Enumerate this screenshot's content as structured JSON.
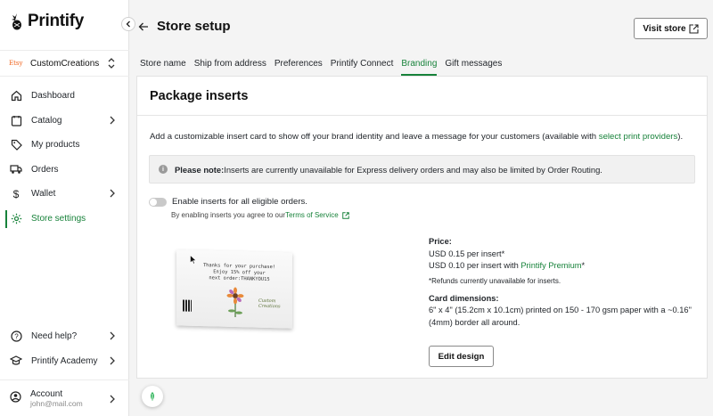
{
  "app": {
    "name": "Printify"
  },
  "store": {
    "platform": "Etsy",
    "name": "CustomCreations"
  },
  "nav": {
    "items": [
      {
        "label": "Dashboard"
      },
      {
        "label": "Catalog"
      },
      {
        "label": "My products"
      },
      {
        "label": "Orders"
      },
      {
        "label": "Wallet"
      },
      {
        "label": "Store settings"
      }
    ],
    "help": "Need help?",
    "academy": "Printify Academy"
  },
  "account": {
    "label": "Account",
    "email": "john@mail.com"
  },
  "header": {
    "title": "Store setup",
    "visit_store": "Visit store"
  },
  "tabs": [
    {
      "label": "Store name"
    },
    {
      "label": "Ship from address"
    },
    {
      "label": "Preferences"
    },
    {
      "label": "Printify Connect"
    },
    {
      "label": "Branding"
    },
    {
      "label": "Gift messages"
    }
  ],
  "inserts": {
    "heading": "Package inserts",
    "description": "Add a customizable insert card to show off your brand identity and leave a message for your customers (available with ",
    "description_link": "select print providers",
    "description_end": ").",
    "note_bold": "Please note:",
    "note_text": " Inserts are currently unavailable for Express delivery orders and may also be limited by Order Routing.",
    "toggle_label": "Enable inserts for all eligible orders.",
    "toggle_on": false,
    "terms_prefix": "By enabling inserts you agree to our ",
    "terms_link": "Terms of Service",
    "card_line1": "Thanks for your purchase!",
    "card_line2": "Enjoy 15% off your",
    "card_line3": "next order:THANKYOU15",
    "card_brand1": "Custom",
    "card_brand2": "Creations",
    "price_label": "Price:",
    "price_line1": "USD 0.15 per insert*",
    "price_line2_prefix": "USD 0.10 per insert with ",
    "price_line2_link": "Printify Premium",
    "price_line2_suffix": "*",
    "refunds_note": "*Refunds currently unavailable for inserts.",
    "dimensions_label": "Card dimensions:",
    "dimensions_line1": "6\" x 4\" (15.2cm x 10.1cm) printed on 150 - 170 gsm paper with a ~0.16\"",
    "dimensions_line2": "(4mm) border all around.",
    "edit_button": "Edit design"
  },
  "colors": {
    "accent": "#17823a",
    "etsy": "#f1641e"
  }
}
